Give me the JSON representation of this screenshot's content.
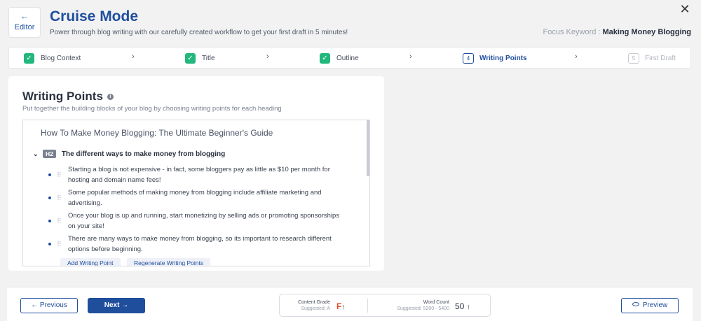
{
  "header": {
    "back_icon": "←",
    "back_label": "Editor",
    "title": "Cruise Mode",
    "subtitle": "Power through blog writing with our carefully created workflow to get your first draft in 5 minutes!",
    "focus_label": "Focus Keyword :",
    "focus_value": "Making Money Blogging",
    "close_icon": "✕"
  },
  "stepper": {
    "steps": [
      {
        "label": "Blog Context",
        "status": "done",
        "mark": "✓"
      },
      {
        "label": "Title",
        "status": "done",
        "mark": "✓"
      },
      {
        "label": "Outline",
        "status": "done",
        "mark": "✓"
      },
      {
        "label": "Writing Points",
        "status": "active",
        "mark": "4"
      },
      {
        "label": "First Draft",
        "status": "upcoming",
        "mark": "5"
      }
    ],
    "chevron": "›"
  },
  "card": {
    "title": "Writing Points",
    "info_icon": "i",
    "subtitle": "Put together the building blocks of your blog by choosing writing points for each heading",
    "blog_title": "How To Make Money Blogging: The Ultimate Beginner's Guide",
    "heading": {
      "caret": "⌄",
      "badge": "H2",
      "text": "The different ways to make money from blogging"
    },
    "points": [
      "Starting a blog is not expensive - in fact, some bloggers pay as little as $10 per month for hosting and domain name fees!",
      "Some popular methods of making money from blogging include affiliate marketing and advertising.",
      "Once your blog is up and running, start monetizing by selling ads or promoting sponsorships on your site!",
      "There are many ways to make money from blogging, so its important to research different options before beginning."
    ],
    "grip_icon": "⠿",
    "add_button": "Add Writing Point",
    "regen_button": "Regenerate Writing Points"
  },
  "footer": {
    "prev_label": "← Previous",
    "next_label": "Next →",
    "grade_label": "Content Grade",
    "grade_suggested": "Suggested: A",
    "grade_value": "F",
    "up_arrow": "↑",
    "wc_label": "Word Count",
    "wc_suggested": "Suggested: 5200 - 5400",
    "wc_value": "50",
    "preview_label": "Preview"
  }
}
